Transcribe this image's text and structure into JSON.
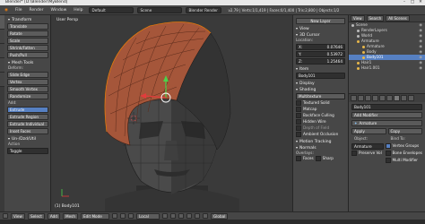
{
  "window": {
    "title": "Blender* [D:\\Blender\\MyBlend]",
    "controls": [
      "–",
      "□",
      "✕"
    ]
  },
  "menubar": {
    "items": [
      "File",
      "Render",
      "Window",
      "Help"
    ],
    "layout": "Default",
    "scene": "Scene",
    "engine": "Blender Render",
    "stats": "v2.79 | Verts:1/1,419 | Faces:0/1,400 | Tris:2,800 | Objects:1/2"
  },
  "toolshelf": {
    "transform_header": "Transform",
    "transform_buttons": [
      "Translate",
      "Rotate",
      "Scale",
      "Shrink/Fatten",
      "Push/Pull"
    ],
    "mesh_tools_header": "Mesh Tools",
    "deform_label": "Deform:",
    "deform_buttons": [
      "Slide Edge",
      "Vertex",
      "Smooth Vertex",
      "Randomize"
    ],
    "add_label": "Add:",
    "extrude": "Extrude",
    "extrude_buttons": [
      "Extrude Region",
      "Extrude Individual"
    ],
    "inset": "Inset Faces",
    "undo_header": "Un-/Dzd/Util",
    "action_header": "Action",
    "action_select": "Toggle"
  },
  "viewport": {
    "label": "User Persp",
    "object": "(1) Body101"
  },
  "npanel": {
    "new_layer": "New Layer",
    "view_header": "View",
    "cursor_header": "3D Cursor",
    "location_label": "Location:",
    "x": {
      "label": "X:",
      "value": "0.07646"
    },
    "y": {
      "label": "Y:",
      "value": "0.53972"
    },
    "z": {
      "label": "Z:",
      "value": "1.25464"
    },
    "item_header": "Item",
    "item_name": "Body101",
    "display_header": "Display",
    "shading_header": "Shading",
    "shading_mode": "Multitexture",
    "checks": [
      "Textured Solid",
      "Matcap",
      "Backface Culling",
      "Hidden Wire",
      "Depth of Field",
      "Ambient Occlusion"
    ],
    "motion_tracking": "Motion Tracking",
    "normals_header": "Normals",
    "overlays_label": "Overlays:",
    "faces": "Faces",
    "sharp": "Sharp"
  },
  "outliner": {
    "header": {
      "view": "View",
      "search": "Search",
      "scene": "All Scenes"
    },
    "rows": [
      {
        "label": "Scene",
        "indent": 0,
        "color": "#bbbbbb"
      },
      {
        "label": "RenderLayers",
        "indent": 1,
        "color": "#bbbbbb"
      },
      {
        "label": "World",
        "indent": 1,
        "color": "#bbbbbb"
      },
      {
        "label": "Armature",
        "indent": 1,
        "color": "#e8b84a"
      },
      {
        "label": "Armature",
        "indent": 2,
        "color": "#e8b84a"
      },
      {
        "label": "Body",
        "indent": 2,
        "color": "#e8b84a"
      },
      {
        "label": "Body101",
        "indent": 2,
        "color": "#e8b84a",
        "selected": true
      },
      {
        "label": "Hair1",
        "indent": 1,
        "color": "#e8b84a"
      },
      {
        "label": "Hair1.001",
        "indent": 1,
        "color": "#e8b84a"
      }
    ]
  },
  "properties": {
    "object_name": "Body101",
    "add_modifier": "Add Modifier",
    "modifier_name": "Armature",
    "apply": "Apply",
    "copy": "Copy",
    "object_label": "Object:",
    "bind_to_label": "Bind To:",
    "object_value": "Armature",
    "vertex_groups": "Vertex Groups",
    "preserve_vol": "Preserve Vol",
    "bone_envelopes": "Bone Envelopes",
    "multi_modifier": "Multi Modifier"
  },
  "statusbar": {
    "view": "View",
    "select": "Select",
    "add": "Add",
    "mesh": "Mesh",
    "mode": "Edit Mode",
    "pivot": "Local",
    "global": "Global"
  }
}
